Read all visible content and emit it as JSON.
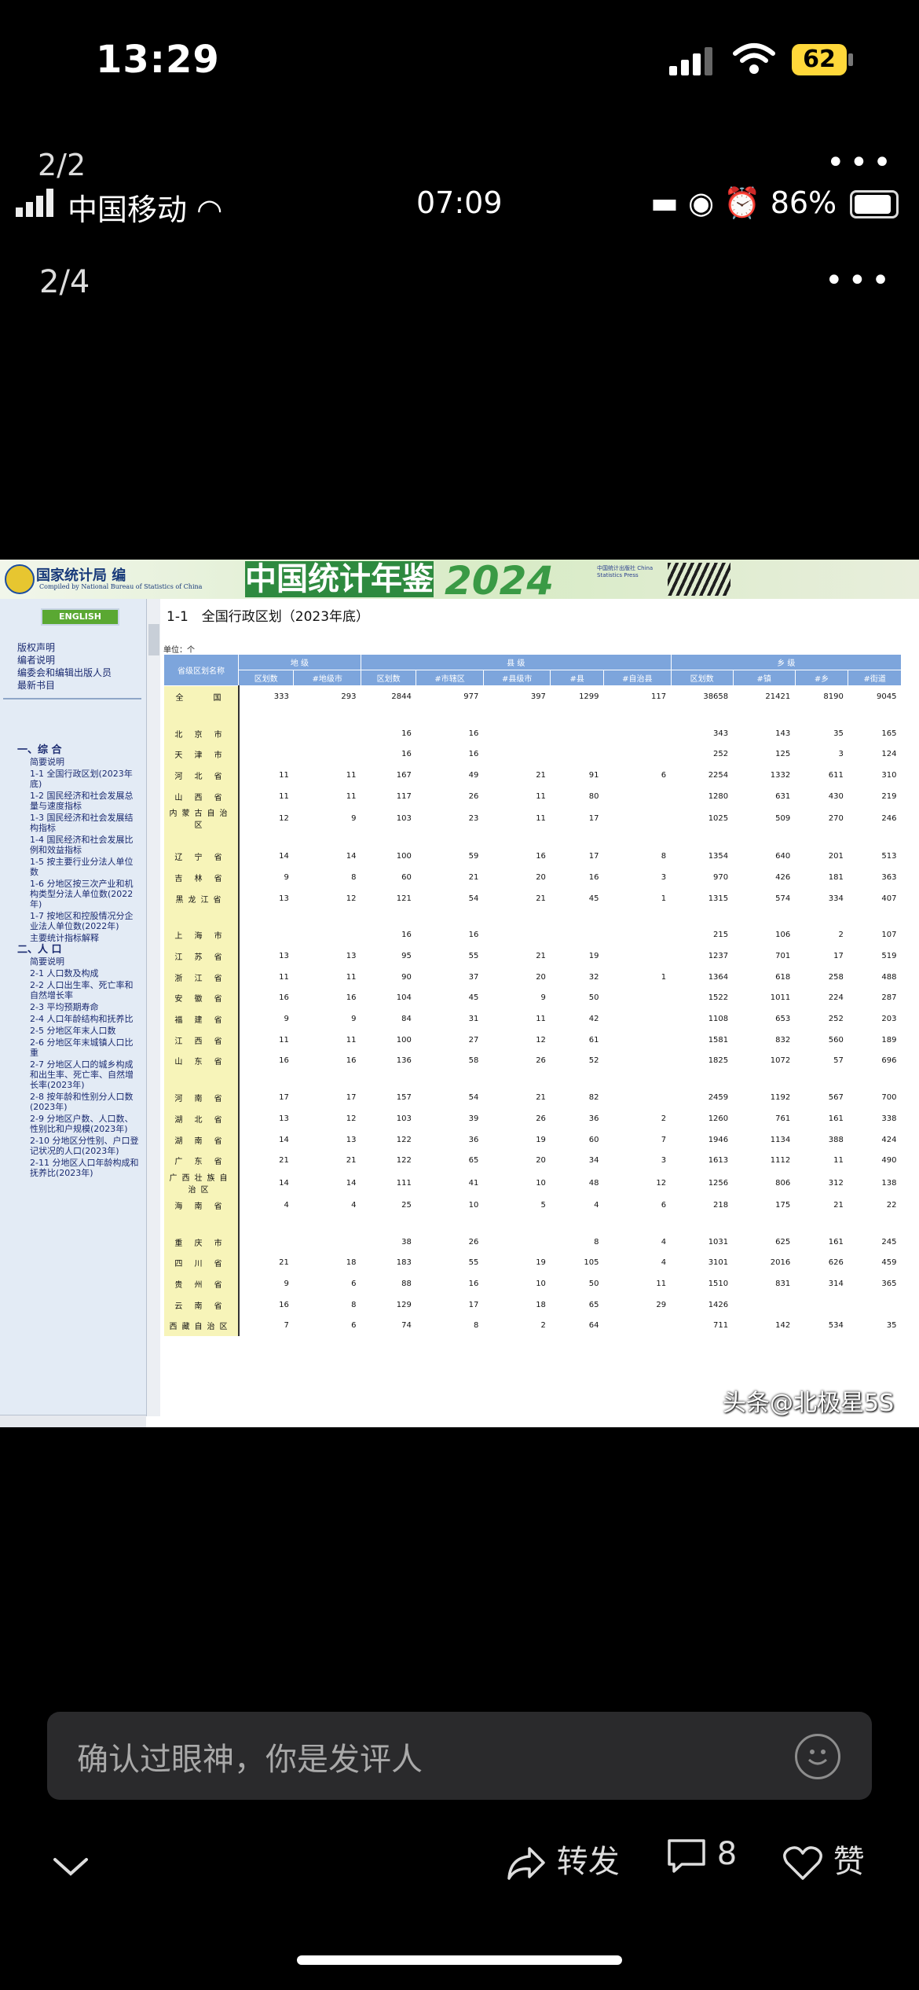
{
  "status": {
    "time": "13:29",
    "battery": "62"
  },
  "viewer": {
    "pager_outer": "2/2",
    "pager_inner": "2/4",
    "more": "•••"
  },
  "inner_status": {
    "carrier": "中国移动",
    "time": "07:09",
    "battery": "86%"
  },
  "yearbook": {
    "org": "国家统计局 编",
    "org_en": "Compiled by National Bureau of Statistics of China",
    "title": "中国统计年鉴",
    "year": "2024",
    "press": "中国统计出版社 China Statistics Press",
    "english_btn": "ENGLISH",
    "side_top": [
      "版权声明",
      "编者说明",
      "编委会和编辑出版人员",
      "最新书目"
    ],
    "tree": [
      {
        "t": "一、综 合",
        "sec": true
      },
      {
        "t": "简要说明"
      },
      {
        "t": "1-1 全国行政区划(2023年底)"
      },
      {
        "t": "1-2 国民经济和社会发展总量与速度指标"
      },
      {
        "t": "1-3 国民经济和社会发展结构指标"
      },
      {
        "t": "1-4 国民经济和社会发展比例和效益指标"
      },
      {
        "t": "1-5 按主要行业分法人单位数"
      },
      {
        "t": "1-6 分地区按三次产业和机构类型分法人单位数(2022年)"
      },
      {
        "t": "1-7 按地区和控股情况分企业法人单位数(2022年)"
      },
      {
        "t": "主要统计指标解释"
      },
      {
        "t": "二、人 口",
        "sec": true
      },
      {
        "t": "简要说明"
      },
      {
        "t": "2-1 人口数及构成"
      },
      {
        "t": "2-2 人口出生率、死亡率和自然增长率"
      },
      {
        "t": "2-3 平均预期寿命"
      },
      {
        "t": "2-4 人口年龄结构和抚养比"
      },
      {
        "t": "2-5 分地区年末人口数"
      },
      {
        "t": "2-6 分地区年末城镇人口比重"
      },
      {
        "t": "2-7 分地区人口的城乡构成和出生率、死亡率、自然增长率(2023年)"
      },
      {
        "t": "2-8 按年龄和性别分人口数(2023年)"
      },
      {
        "t": "2-9 分地区户数、人口数、性别比和户规模(2023年)"
      },
      {
        "t": "2-10 分地区分性别、户口登记状况的人口(2023年)"
      },
      {
        "t": "2-11 分地区人口年龄构成和抚养比(2023年)"
      }
    ],
    "table_title": "1-1　全国行政区划（2023年底）",
    "unit": "单位：个",
    "header_groups": [
      "省级区划名称",
      "地 级",
      "县 级",
      "乡 级"
    ],
    "headers": [
      "区划数",
      "#地级市",
      "区划数",
      "#市辖区",
      "#县级市",
      "#县",
      "#自治县",
      "区划数",
      "#镇",
      "#乡",
      "#街道"
    ],
    "rows": [
      [
        "全　　国",
        "333",
        "293",
        "2844",
        "977",
        "397",
        "1299",
        "117",
        "38658",
        "21421",
        "8190",
        "9045"
      ],
      [
        "",
        "",
        "",
        "",
        "",
        "",
        "",
        "",
        "",
        "",
        "",
        ""
      ],
      [
        "北 京 市",
        "",
        "",
        "16",
        "16",
        "",
        "",
        "",
        "343",
        "143",
        "35",
        "165"
      ],
      [
        "天 津 市",
        "",
        "",
        "16",
        "16",
        "",
        "",
        "",
        "252",
        "125",
        "3",
        "124"
      ],
      [
        "河 北 省",
        "11",
        "11",
        "167",
        "49",
        "21",
        "91",
        "6",
        "2254",
        "1332",
        "611",
        "310"
      ],
      [
        "山 西 省",
        "11",
        "11",
        "117",
        "26",
        "11",
        "80",
        "",
        "1280",
        "631",
        "430",
        "219"
      ],
      [
        "内蒙古自治区",
        "12",
        "9",
        "103",
        "23",
        "11",
        "17",
        "",
        "1025",
        "509",
        "270",
        "246"
      ],
      [
        "",
        "",
        "",
        "",
        "",
        "",
        "",
        "",
        "",
        "",
        "",
        ""
      ],
      [
        "辽 宁 省",
        "14",
        "14",
        "100",
        "59",
        "16",
        "17",
        "8",
        "1354",
        "640",
        "201",
        "513"
      ],
      [
        "吉 林 省",
        "9",
        "8",
        "60",
        "21",
        "20",
        "16",
        "3",
        "970",
        "426",
        "181",
        "363"
      ],
      [
        "黑龙江省",
        "13",
        "12",
        "121",
        "54",
        "21",
        "45",
        "1",
        "1315",
        "574",
        "334",
        "407"
      ],
      [
        "",
        "",
        "",
        "",
        "",
        "",
        "",
        "",
        "",
        "",
        "",
        ""
      ],
      [
        "上 海 市",
        "",
        "",
        "16",
        "16",
        "",
        "",
        "",
        "215",
        "106",
        "2",
        "107"
      ],
      [
        "江 苏 省",
        "13",
        "13",
        "95",
        "55",
        "21",
        "19",
        "",
        "1237",
        "701",
        "17",
        "519"
      ],
      [
        "浙 江 省",
        "11",
        "11",
        "90",
        "37",
        "20",
        "32",
        "1",
        "1364",
        "618",
        "258",
        "488"
      ],
      [
        "安 徽 省",
        "16",
        "16",
        "104",
        "45",
        "9",
        "50",
        "",
        "1522",
        "1011",
        "224",
        "287"
      ],
      [
        "福 建 省",
        "9",
        "9",
        "84",
        "31",
        "11",
        "42",
        "",
        "1108",
        "653",
        "252",
        "203"
      ],
      [
        "江 西 省",
        "11",
        "11",
        "100",
        "27",
        "12",
        "61",
        "",
        "1581",
        "832",
        "560",
        "189"
      ],
      [
        "山 东 省",
        "16",
        "16",
        "136",
        "58",
        "26",
        "52",
        "",
        "1825",
        "1072",
        "57",
        "696"
      ],
      [
        "",
        "",
        "",
        "",
        "",
        "",
        "",
        "",
        "",
        "",
        "",
        ""
      ],
      [
        "河 南 省",
        "17",
        "17",
        "157",
        "54",
        "21",
        "82",
        "",
        "2459",
        "1192",
        "567",
        "700"
      ],
      [
        "湖 北 省",
        "13",
        "12",
        "103",
        "39",
        "26",
        "36",
        "2",
        "1260",
        "761",
        "161",
        "338"
      ],
      [
        "湖 南 省",
        "14",
        "13",
        "122",
        "36",
        "19",
        "60",
        "7",
        "1946",
        "1134",
        "388",
        "424"
      ],
      [
        "广 东 省",
        "21",
        "21",
        "122",
        "65",
        "20",
        "34",
        "3",
        "1613",
        "1112",
        "11",
        "490"
      ],
      [
        "广西壮族自治区",
        "14",
        "14",
        "111",
        "41",
        "10",
        "48",
        "12",
        "1256",
        "806",
        "312",
        "138"
      ],
      [
        "海 南 省",
        "4",
        "4",
        "25",
        "10",
        "5",
        "4",
        "6",
        "218",
        "175",
        "21",
        "22"
      ],
      [
        "",
        "",
        "",
        "",
        "",
        "",
        "",
        "",
        "",
        "",
        "",
        ""
      ],
      [
        "重 庆 市",
        "",
        "",
        "38",
        "26",
        "",
        "8",
        "4",
        "1031",
        "625",
        "161",
        "245"
      ],
      [
        "四 川 省",
        "21",
        "18",
        "183",
        "55",
        "19",
        "105",
        "4",
        "3101",
        "2016",
        "626",
        "459"
      ],
      [
        "贵 州 省",
        "9",
        "6",
        "88",
        "16",
        "10",
        "50",
        "11",
        "1510",
        "831",
        "314",
        "365"
      ],
      [
        "云 南 省",
        "16",
        "8",
        "129",
        "17",
        "18",
        "65",
        "29",
        "1426",
        "",
        "",
        ""
      ],
      [
        "西藏自治区",
        "7",
        "6",
        "74",
        "8",
        "2",
        "64",
        "",
        "711",
        "142",
        "534",
        "35"
      ]
    ]
  },
  "watermark": "头条@北极星5S",
  "comment": {
    "placeholder": "确认过眼神，你是发评人"
  },
  "actions": {
    "forward": "转发",
    "comments": "8",
    "like": "赞"
  }
}
